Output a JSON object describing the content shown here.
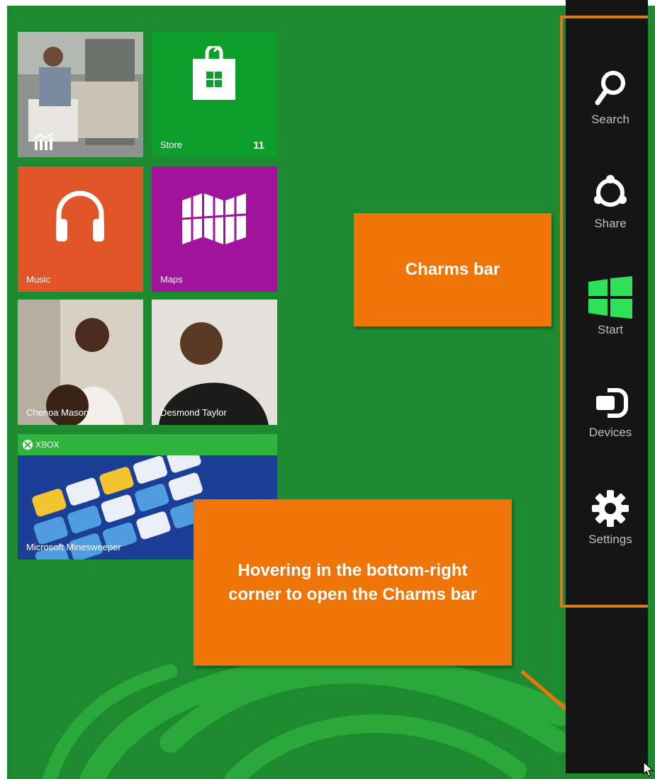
{
  "tiles": {
    "finance": {
      "icon": "chart-icon"
    },
    "store": {
      "label": "Store",
      "count": "11",
      "color": "#0e9e2c"
    },
    "music": {
      "label": "Music",
      "color": "#e05428"
    },
    "maps": {
      "label": "Maps",
      "color": "#a1139b"
    },
    "photo_left": {
      "label": "Chenoa Mason"
    },
    "photo_right": {
      "label": "Desmond Taylor"
    },
    "minesweeper": {
      "header": "XBOX",
      "label": "Microsoft Minesweeper",
      "header_color": "#30b33f"
    }
  },
  "charms": [
    {
      "label": "Search",
      "icon": "search-icon"
    },
    {
      "label": "Share",
      "icon": "share-icon"
    },
    {
      "label": "Start",
      "icon": "windows-logo-icon"
    },
    {
      "label": "Devices",
      "icon": "devices-icon"
    },
    {
      "label": "Settings",
      "icon": "gear-icon"
    }
  ],
  "annotations": {
    "charms_bar": "Charms bar",
    "hover_hint": "Hovering in the bottom-right corner to open the Charms bar",
    "accent": "#f07508"
  },
  "colors": {
    "background": "#1e8a2f",
    "charms_bg": "#151515",
    "start_green": "#2ee05a"
  }
}
